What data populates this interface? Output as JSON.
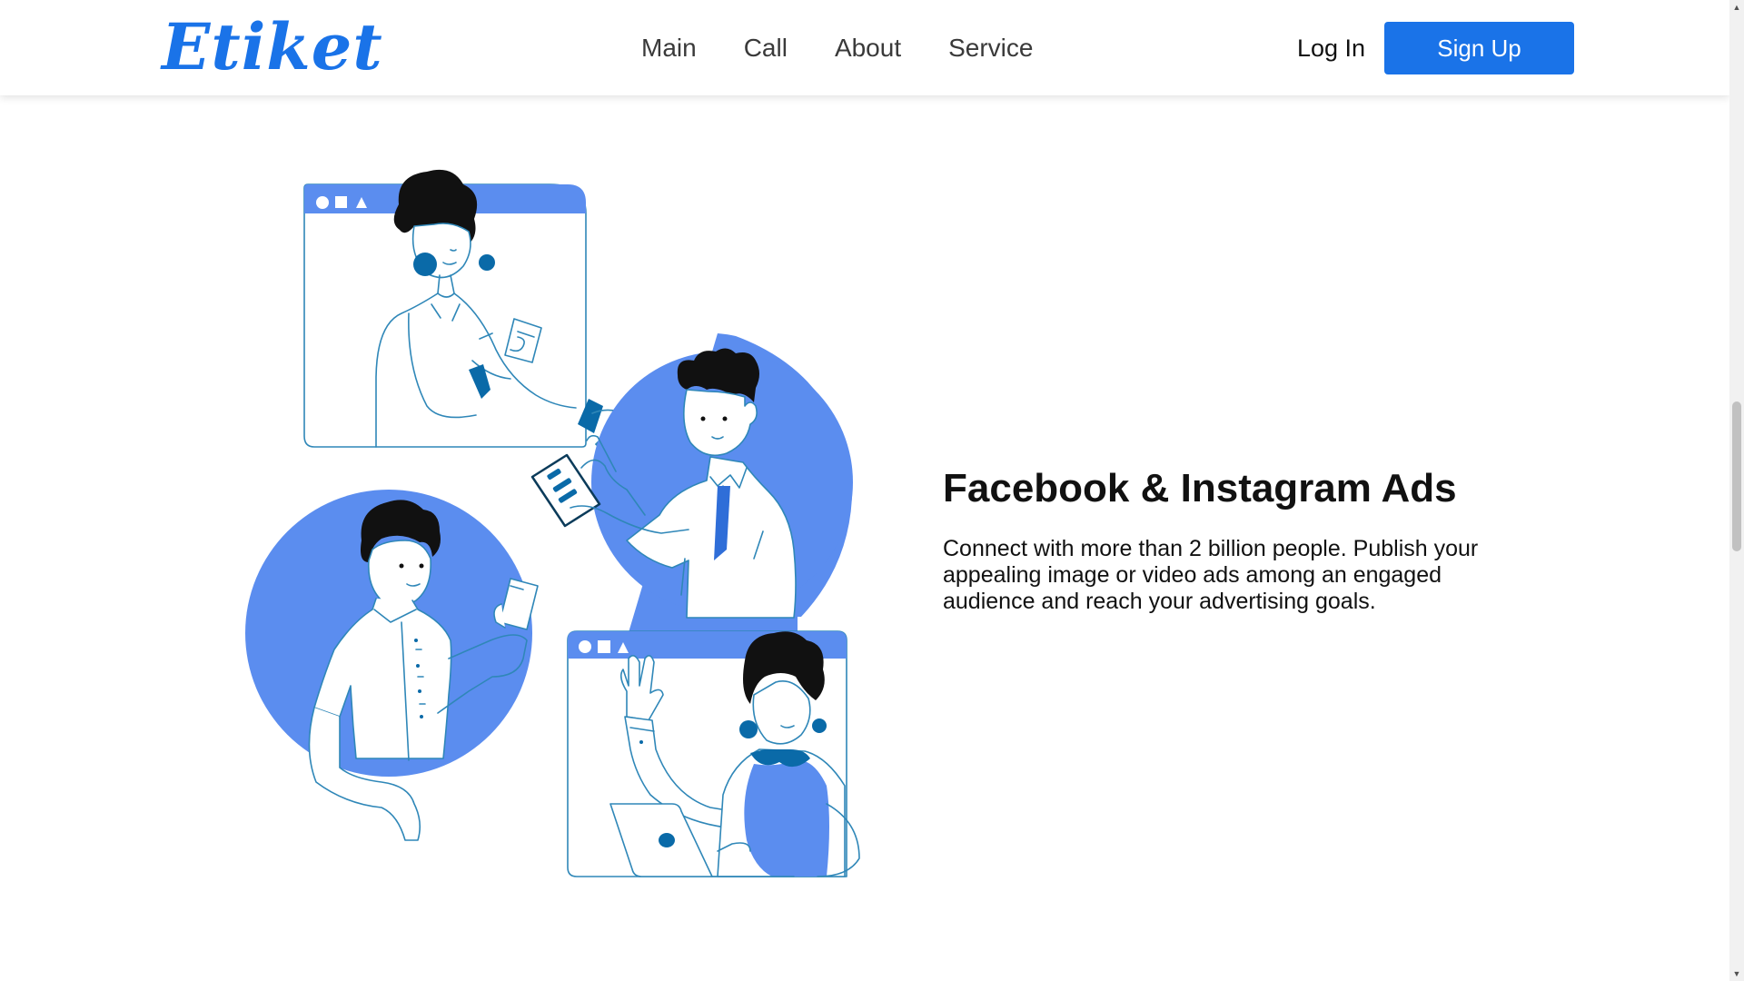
{
  "navbar": {
    "logo": "Etiket",
    "links": [
      "Main",
      "Call",
      "About",
      "Service"
    ],
    "login_label": "Log In",
    "signup_label": "Sign Up"
  },
  "hero": {
    "title": "Facebook & Instagram Ads",
    "description": "Connect with more than 2 billion people. Publish your appealing image or video ads among an engaged audience and reach your advertising goals."
  },
  "colors": {
    "accent": "#1a73e8",
    "illustration_blue": "#5b8def",
    "illustration_dark_blue": "#0a6aa8",
    "illustration_line": "#2f87b8"
  },
  "icons": {
    "scroll_up": "triangle-up-icon",
    "scroll_down": "triangle-down-icon"
  },
  "scrollbar": {
    "position": 0.5
  }
}
